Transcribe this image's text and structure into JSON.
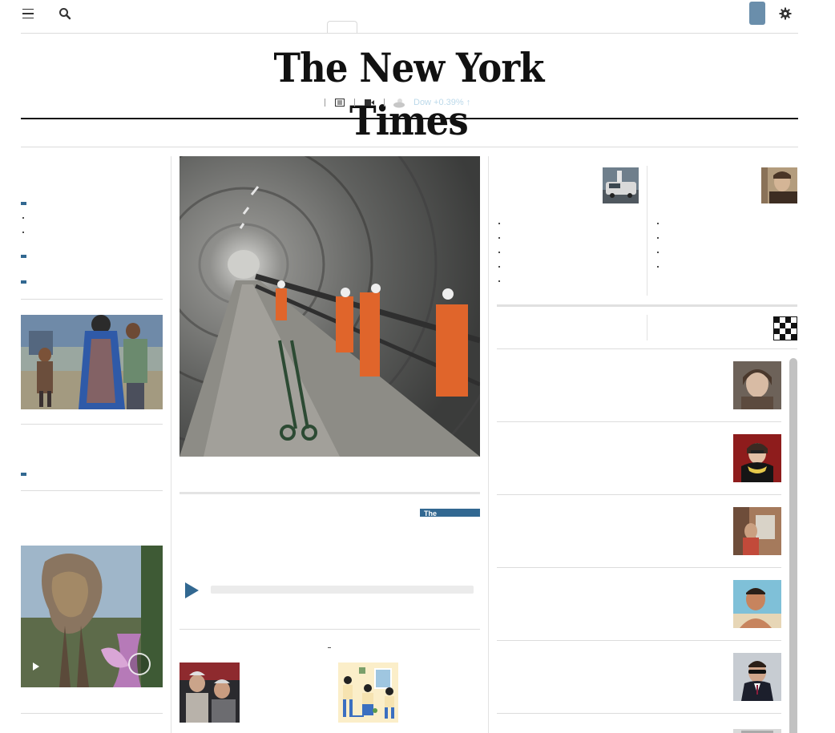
{
  "header": {
    "menu_icon": "hamburger-icon",
    "search_icon": "search-icon",
    "settings_icon": "gear-icon",
    "account_color": "#6a8eab",
    "masthead": "The New York Times",
    "sections_icon": "newspaper-icon",
    "video_icon": "video-camera-icon",
    "weather_icon": "cloud-sun-icon",
    "weather_text": "Dow +0.39% ↑"
  },
  "colors": {
    "accent": "#326891",
    "rule": "#dcdcdc",
    "text": "#121212"
  },
  "media": {
    "audio_play_icon": "play-icon",
    "video_play_icon": "play-icon",
    "video_mute_icon": "mute-icon",
    "promo_banner": "The"
  },
  "right_rail": {
    "crossword_icon": "crossword-icon"
  }
}
